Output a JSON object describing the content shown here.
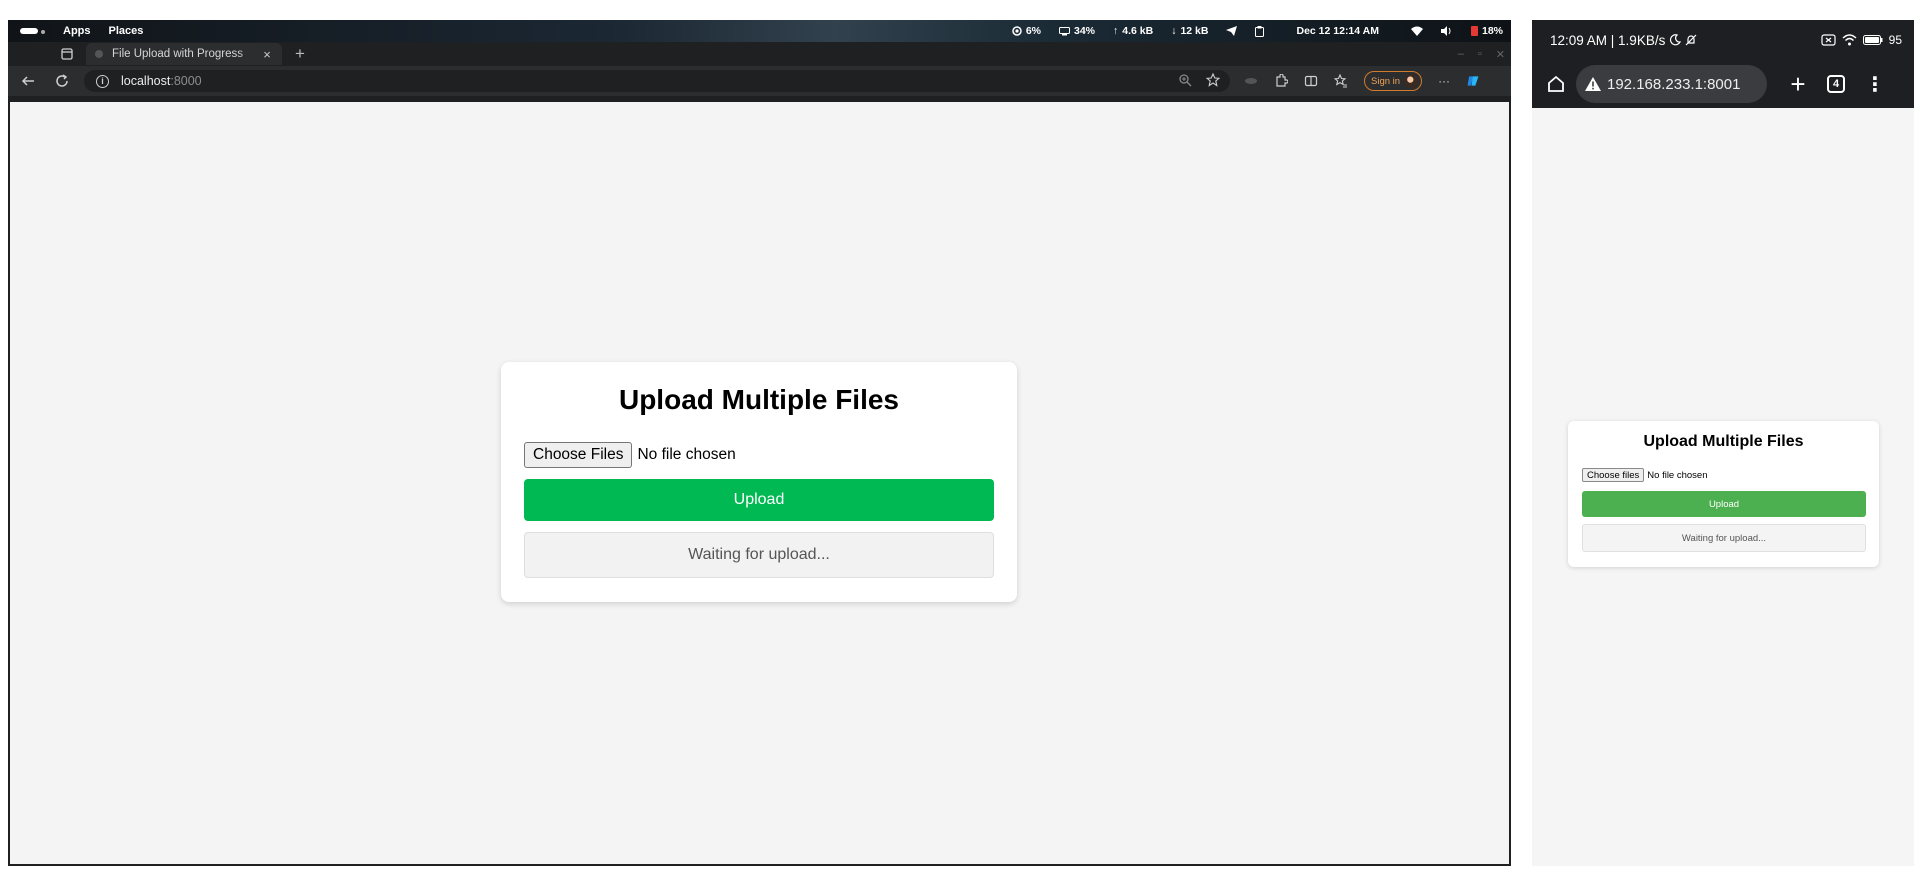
{
  "desktop": {
    "topbar": {
      "apps_label": "Apps",
      "places_label": "Places",
      "cpu": "6%",
      "memory": "34%",
      "upload_speed": "4.6 kB",
      "download_speed": "12 kB",
      "datetime": "Dec 12  12:14 AM",
      "battery": "18%"
    },
    "browser": {
      "tab_title": "File Upload with Progress",
      "url_host": "localhost",
      "url_port": ":8000",
      "signin_label": "Sign in",
      "more_label": "···"
    },
    "page": {
      "title": "Upload Multiple Files",
      "choose_files_label": "Choose Files",
      "no_file_text": "No file chosen",
      "upload_label": "Upload",
      "status_text": "Waiting for upload..."
    }
  },
  "mobile": {
    "status_bar": {
      "time_speed": "12:09 AM | 1.9KB/s",
      "battery": "95"
    },
    "browser": {
      "url": "192.168.233.1:8001",
      "tab_count": "4"
    },
    "page": {
      "title": "Upload Multiple Files",
      "choose_files_label": "Choose files",
      "no_file_text": "No file chosen",
      "upload_label": "Upload",
      "status_text": "Waiting for upload..."
    }
  },
  "colors": {
    "upload_green_desktop": "#00b953",
    "upload_green_mobile": "#4caf50",
    "signin_orange": "#d07b2b",
    "battery_low_red": "#e53935"
  }
}
